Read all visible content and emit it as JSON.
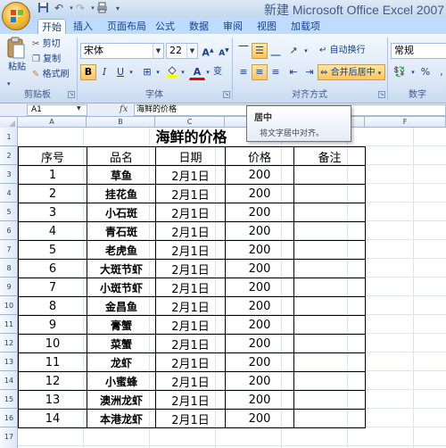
{
  "window": {
    "title": "新建 Microsoft Office Excel 2007 \\"
  },
  "quick_access": {
    "save_icon": "save-icon",
    "undo_icon": "undo-icon",
    "redo_icon": "redo-icon",
    "print_icon": "print-icon"
  },
  "tabs": [
    {
      "label": "开始",
      "active": true
    },
    {
      "label": "插入"
    },
    {
      "label": "页面布局"
    },
    {
      "label": "公式"
    },
    {
      "label": "数据"
    },
    {
      "label": "审阅"
    },
    {
      "label": "视图"
    },
    {
      "label": "加载项"
    }
  ],
  "ribbon": {
    "clipboard": {
      "paste": "粘贴",
      "cut": "剪切",
      "copy": "复制",
      "format_painter": "格式刷",
      "label": "剪贴板"
    },
    "font": {
      "name": "宋体",
      "size": "22",
      "bold": "B",
      "italic": "I",
      "underline": "U",
      "grow": "A",
      "shrink": "A",
      "color_a": "A",
      "phonetic": "变",
      "label": "字体"
    },
    "alignment": {
      "wrap": "自动换行",
      "merge": "合并后居中",
      "label": "对齐方式"
    },
    "number": {
      "format": "常规",
      "percent": "%",
      "comma": ",",
      "label": "数字"
    }
  },
  "formula_bar": {
    "cell": "A1",
    "fx": "fx",
    "content": "海鲜的价格"
  },
  "tooltip": {
    "title": "居中",
    "body": "将文字居中对齐。"
  },
  "columns": [
    "A",
    "B",
    "C",
    "D",
    "E",
    "F"
  ],
  "rows": [
    "1",
    "2",
    "3",
    "4",
    "5",
    "6",
    "7",
    "8",
    "9",
    "10",
    "11",
    "12",
    "13",
    "14",
    "15",
    "16",
    "17"
  ],
  "sheet": {
    "title": "海鲜的价格",
    "headers": [
      "序号",
      "品名",
      "日期",
      "价格",
      "备注"
    ],
    "records": [
      [
        "1",
        "草鱼",
        "2月1日",
        "200",
        ""
      ],
      [
        "2",
        "挂花鱼",
        "2月1日",
        "200",
        ""
      ],
      [
        "3",
        "小石斑",
        "2月1日",
        "200",
        ""
      ],
      [
        "4",
        "青石斑",
        "2月1日",
        "200",
        ""
      ],
      [
        "5",
        "老虎鱼",
        "2月1日",
        "200",
        ""
      ],
      [
        "6",
        "大斑节虾",
        "2月1日",
        "200",
        ""
      ],
      [
        "7",
        "小斑节虾",
        "2月1日",
        "200",
        ""
      ],
      [
        "8",
        "金昌鱼",
        "2月1日",
        "200",
        ""
      ],
      [
        "9",
        "膏蟹",
        "2月1日",
        "200",
        ""
      ],
      [
        "10",
        "菜蟹",
        "2月1日",
        "200",
        ""
      ],
      [
        "11",
        "龙虾",
        "2月1日",
        "200",
        ""
      ],
      [
        "12",
        "小蜜蜂",
        "2月1日",
        "200",
        ""
      ],
      [
        "13",
        "澳洲龙虾",
        "2月1日",
        "200",
        ""
      ],
      [
        "14",
        "本港龙虾",
        "2月1日",
        "200",
        ""
      ]
    ]
  },
  "colors": {
    "ribbon_tab_bg": "#bfdbff",
    "pressed": "#ffc45a",
    "grid": "#dbe4ef"
  }
}
